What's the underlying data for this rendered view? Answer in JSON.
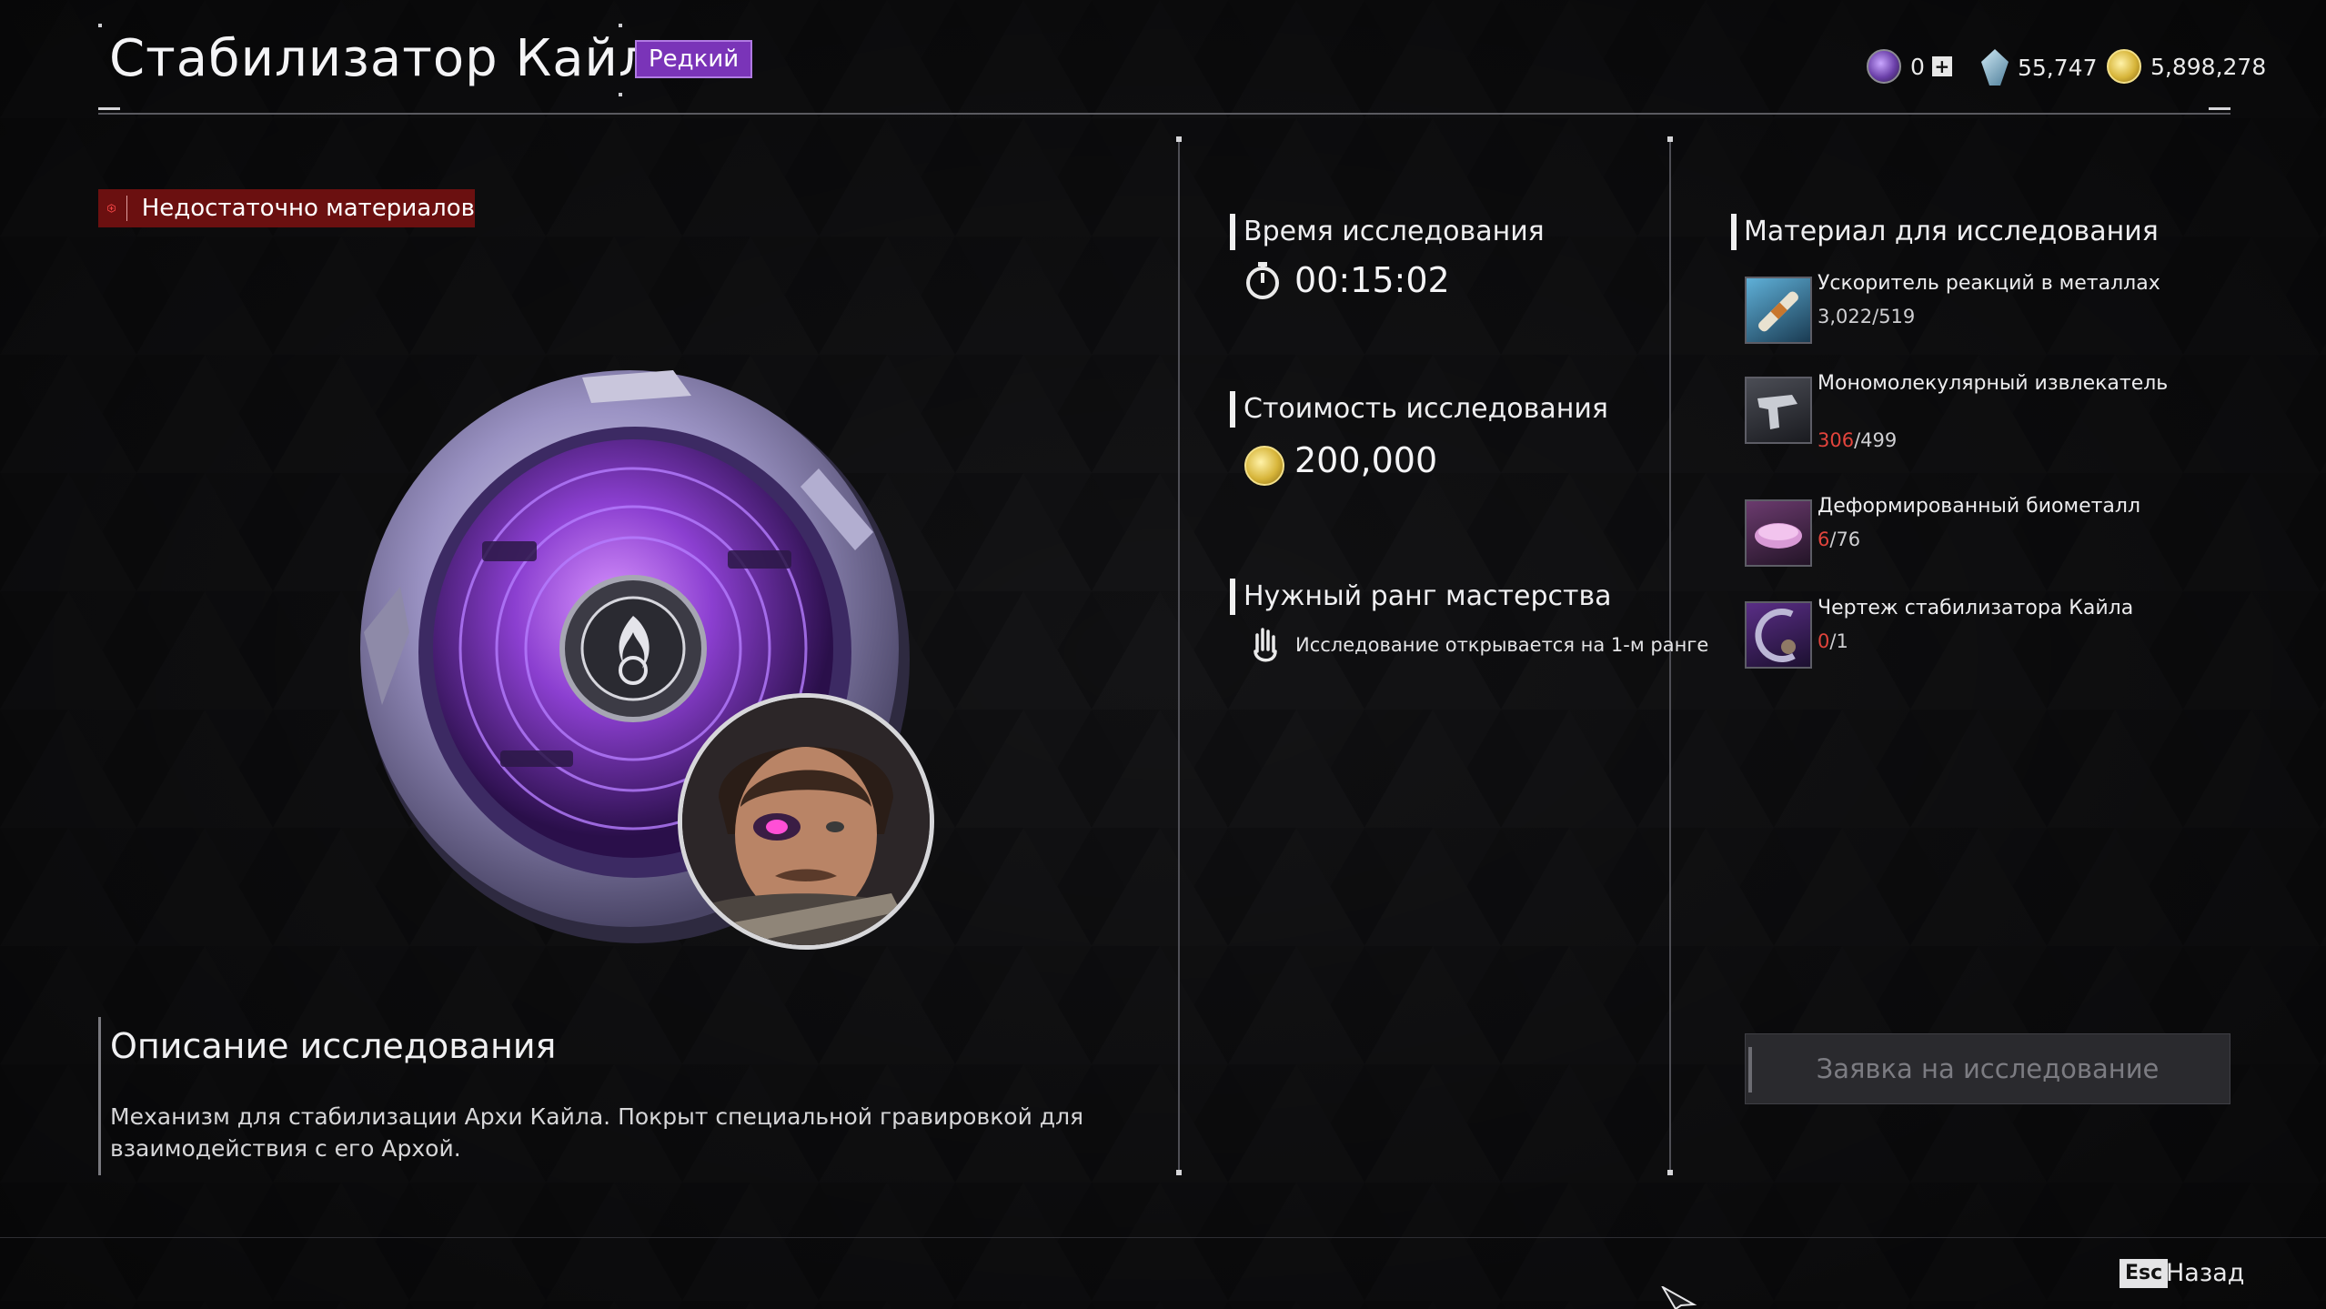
{
  "header": {
    "title": "Стабилизатор Кайла",
    "rarity": "Редкий"
  },
  "currencies": [
    {
      "icon": "orb-currency-icon",
      "value": "0"
    },
    {
      "icon": "crystal-currency-icon",
      "value": "55,747"
    },
    {
      "icon": "gold-coin-icon",
      "value": "5,898,278"
    }
  ],
  "warning": {
    "text": "Недостаточно материалов",
    "icon": "warning-hex-icon"
  },
  "description": {
    "title": "Описание исследования",
    "text": "Механизм для стабилизации Архи Кайла. Покрыт специальной гравировкой для взаимодействия с его Архой."
  },
  "research": {
    "time_title": "Время исследования",
    "time_value": "00:15:02",
    "cost_title": "Стоимость исследования",
    "cost_value": "200,000",
    "rank_title": "Нужный ранг мастерства",
    "rank_text": "Исследование открывается на 1-м ранге"
  },
  "materials": {
    "title": "Материал для исследования",
    "items": [
      {
        "name": "Ускоритель реакций в металлах",
        "have": "3,022",
        "need": "/519",
        "insufficient": false,
        "icon": "metal-reaction-accelerator-icon"
      },
      {
        "name": "Мономолекулярный извлекатель",
        "have": "306",
        "need": "/499",
        "insufficient": true,
        "icon": "monomolecular-extractor-icon"
      },
      {
        "name": "Деформированный биометалл",
        "have": "6",
        "need": "/76",
        "insufficient": true,
        "icon": "deformed-biometal-icon"
      },
      {
        "name": "Чертеж стабилизатора Кайла",
        "have": "0",
        "need": "/1",
        "insufficient": true,
        "icon": "stabilizer-blueprint-icon"
      }
    ]
  },
  "apply_button": "Заявка на исследование",
  "footer": {
    "key": "Esc",
    "label": "Назад"
  },
  "colors": {
    "rarity_purple": "#7a34b8",
    "warning_red": "#6b1010",
    "insufficient_red": "#e2443c"
  }
}
